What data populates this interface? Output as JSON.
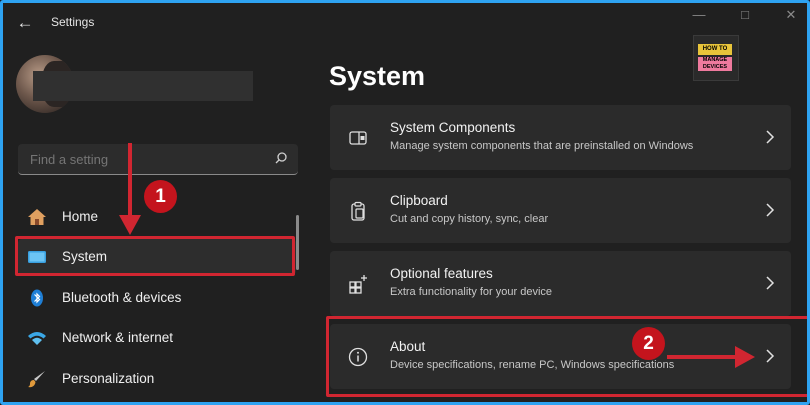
{
  "window": {
    "title": "Settings"
  },
  "search": {
    "placeholder": "Find a setting"
  },
  "sidebar": {
    "items": [
      {
        "label": "Home"
      },
      {
        "label": "System"
      },
      {
        "label": "Bluetooth & devices"
      },
      {
        "label": "Network & internet"
      },
      {
        "label": "Personalization"
      }
    ]
  },
  "main": {
    "title": "System",
    "cards": [
      {
        "title": "System Components",
        "desc": "Manage system components that are preinstalled on Windows"
      },
      {
        "title": "Clipboard",
        "desc": "Cut and copy history, sync, clear"
      },
      {
        "title": "Optional features",
        "desc": "Extra functionality for your device"
      },
      {
        "title": "About",
        "desc": "Device specifications, rename PC, Windows specifications"
      }
    ]
  },
  "annotations": {
    "step1": "1",
    "step2": "2"
  },
  "logo": {
    "line1": "HOW TO",
    "line2": "MANAGE DEVICES"
  },
  "colors": {
    "accent_blue": "#2ea3f2",
    "annotation_red": "#d12631",
    "background": "#202020",
    "card": "#2b2b2b"
  }
}
